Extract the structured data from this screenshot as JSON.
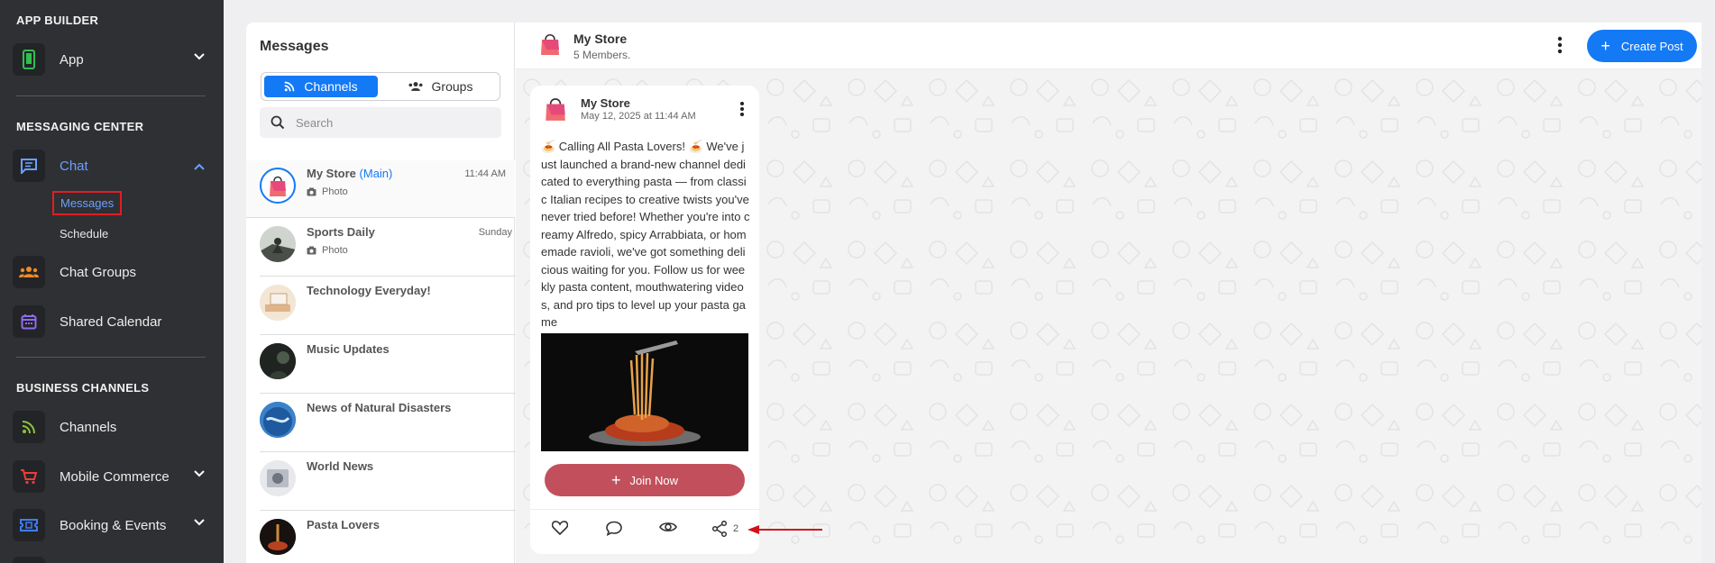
{
  "sidebar": {
    "app_builder_title": "APP BUILDER",
    "app_label": "App",
    "messaging_title": "MESSAGING CENTER",
    "chat_label": "Chat",
    "messages_label": "Messages",
    "schedule_label": "Schedule",
    "chat_groups_label": "Chat Groups",
    "shared_calendar_label": "Shared Calendar",
    "business_title": "BUSINESS CHANNELS",
    "channels_label": "Channels",
    "mobile_commerce_label": "Mobile Commerce",
    "booking_label": "Booking & Events",
    "colors": {
      "app_icon": "#2fbf4f",
      "chat_active": "#6aa0ff",
      "groups_icon": "#f08a24",
      "calendar_icon": "#8f6cf0",
      "channels_icon": "#8fc33a",
      "commerce_icon": "#f03b3b",
      "booking_icon": "#3f7df5"
    }
  },
  "messages": {
    "title": "Messages",
    "tab_channels": "Channels",
    "tab_groups": "Groups",
    "search_placeholder": "Search",
    "items": [
      {
        "name": "My Store",
        "tag": "(Main)",
        "time": "11:44 AM",
        "sub": "Photo"
      },
      {
        "name": "Sports Daily",
        "tag": "",
        "time": "Sunday",
        "sub": "Photo"
      },
      {
        "name": "Technology Everyday!",
        "tag": "",
        "time": "",
        "sub": ""
      },
      {
        "name": "Music Updates",
        "tag": "",
        "time": "",
        "sub": ""
      },
      {
        "name": "News of Natural Disasters",
        "tag": "",
        "time": "",
        "sub": ""
      },
      {
        "name": "World News",
        "tag": "",
        "time": "",
        "sub": ""
      },
      {
        "name": "Pasta Lovers",
        "tag": "",
        "time": "",
        "sub": ""
      }
    ]
  },
  "chat": {
    "header_name": "My Store",
    "header_members": "5 Members.",
    "create_post_label": "Create Post",
    "post": {
      "author": "My Store",
      "date": "May 12, 2025 at 11:44 AM",
      "text": "🍝 Calling All Pasta Lovers! 🍝 We've just launched a brand-new channel dedicated to everything pasta — from classic Italian recipes to creative twists you've never tried before! Whether you're into creamy Alfredo, spicy Arrabbiata, or homemade ravioli, we've got something delicious waiting for you. Follow us for weekly pasta content, mouthwatering videos, and pro tips to level up your pasta game",
      "join_label": "Join Now",
      "share_count": "2"
    }
  },
  "icons": {
    "more": "more-vertical-icon",
    "like": "heart-icon",
    "comment": "comment-icon",
    "views": "eye-icon",
    "share": "share-icon"
  }
}
